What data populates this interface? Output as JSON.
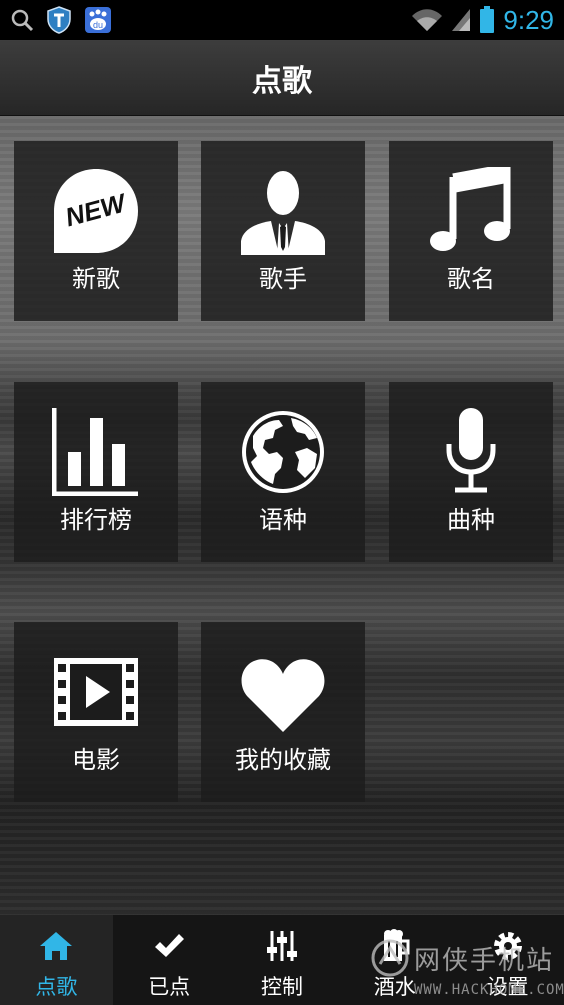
{
  "status_bar": {
    "time": "9:29",
    "icons": [
      "search-icon",
      "shield-icon",
      "baidu-icon",
      "wifi-icon",
      "signal-icon",
      "battery-icon"
    ],
    "baidu_text": "du",
    "accent_color": "#31b6e7"
  },
  "header": {
    "title": "点歌"
  },
  "tiles": [
    {
      "label": "新歌",
      "icon": "new-badge-icon",
      "badge_text": "NEW"
    },
    {
      "label": "歌手",
      "icon": "singer-icon"
    },
    {
      "label": "歌名",
      "icon": "music-note-icon"
    },
    {
      "label": "排行榜",
      "icon": "bar-chart-icon"
    },
    {
      "label": "语种",
      "icon": "globe-icon"
    },
    {
      "label": "曲种",
      "icon": "microphone-icon"
    },
    {
      "label": "电影",
      "icon": "film-icon"
    },
    {
      "label": "我的收藏",
      "icon": "heart-icon"
    }
  ],
  "bottom_nav": [
    {
      "label": "点歌",
      "icon": "home-icon",
      "active": true
    },
    {
      "label": "已点",
      "icon": "check-icon",
      "active": false
    },
    {
      "label": "控制",
      "icon": "sliders-icon",
      "active": false
    },
    {
      "label": "酒水",
      "icon": "beer-icon",
      "active": false
    },
    {
      "label": "设置",
      "icon": "gear-icon",
      "active": false
    }
  ],
  "watermark": {
    "text": "网侠手机站",
    "subtext": "WWW.HACKHOME.COM"
  }
}
